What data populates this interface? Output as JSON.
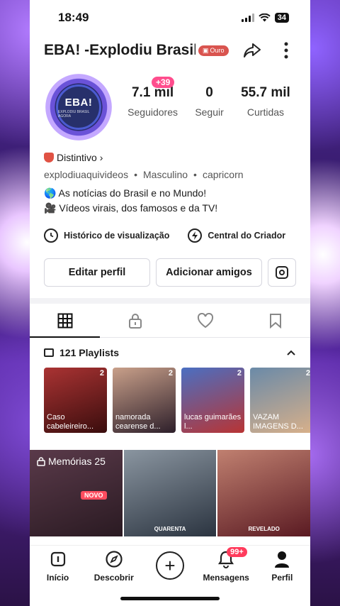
{
  "status": {
    "time": "18:49",
    "battery": "34"
  },
  "header": {
    "username": "EBA! -Explodiu Brasil",
    "tier": "Ouro"
  },
  "avatar": {
    "text": "EBA!",
    "subtext": "EXPLODIU BRASIL AGORA",
    "new_followers": "+39"
  },
  "stats": [
    {
      "value": "7.1 mil",
      "label": "Seguidores"
    },
    {
      "value": "0",
      "label": "Seguir"
    },
    {
      "value": "55.7 mil",
      "label": "Curtidas"
    }
  ],
  "badge": {
    "label": "Distintivo",
    "chevron": "›"
  },
  "meta": {
    "handle": "explodiuaquivideos",
    "gender": "Masculino",
    "sign": "capricorn",
    "sep": "•"
  },
  "bio": [
    "🌎 As notícias do Brasil e no Mundo!",
    "🎥 Vídeos virais, dos famosos e da TV!"
  ],
  "shortcuts": {
    "history": "Histórico de visualização",
    "creator": "Central do Criador"
  },
  "actions": {
    "edit": "Editar perfil",
    "add_friends": "Adicionar amigos"
  },
  "playlists": {
    "label": "121 Playlists",
    "items": [
      {
        "count": "2",
        "title": "Caso cabeleireiro...",
        "color": "#6b1f1f"
      },
      {
        "count": "2",
        "title": "namorada cearense d...",
        "color": "#3a2a3a"
      },
      {
        "count": "2",
        "title": "lucas guimarães l...",
        "color": "#2f4f8c"
      },
      {
        "count": "2",
        "title": "VAZAM IMAGENS D...",
        "color": "#8a6a55"
      }
    ]
  },
  "memories": {
    "label": "Memórias 25",
    "new": "NOVO"
  },
  "grid": [
    {
      "tag": "",
      "color": "#5a3a4a"
    },
    {
      "tag": "QUARENTA",
      "color": "#3c4550"
    },
    {
      "tag": "REVELADO",
      "color": "#7a3038"
    }
  ],
  "nav": {
    "home": "Início",
    "discover": "Descobrir",
    "create": "+",
    "messages": "Mensagens",
    "messages_badge": "99+",
    "profile": "Perfil"
  }
}
